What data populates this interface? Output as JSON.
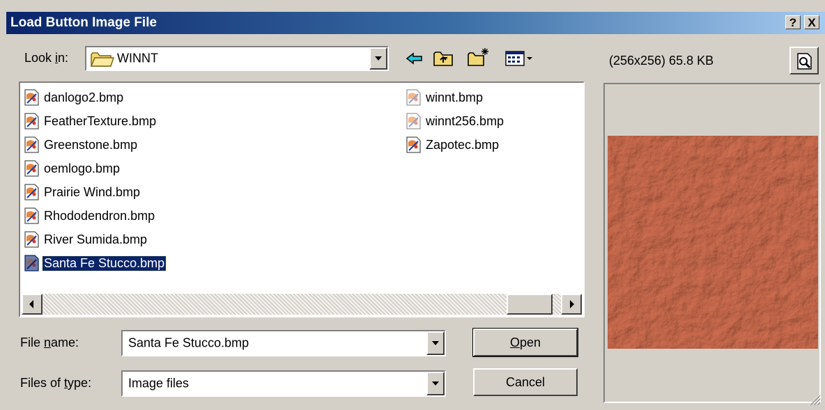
{
  "dialog": {
    "title": "Load Button Image File",
    "help_btn": "?",
    "close_btn": "X"
  },
  "lookin": {
    "label_pre": "Look ",
    "label_key": "i",
    "label_post": "n:",
    "value": "WINNT"
  },
  "preview": {
    "info": "(256x256)  65.8 KB",
    "image_color": "#c97a5f"
  },
  "files": [
    {
      "name": "danlogo2.bmp"
    },
    {
      "name": "FeatherTexture.bmp"
    },
    {
      "name": "Greenstone.bmp"
    },
    {
      "name": "oemlogo.bmp"
    },
    {
      "name": "Prairie Wind.bmp"
    },
    {
      "name": "Rhododendron.bmp"
    },
    {
      "name": "River Sumida.bmp"
    },
    {
      "name": "Santa Fe Stucco.bmp",
      "selected": true
    },
    {
      "name": "winnt.bmp"
    },
    {
      "name": "winnt256.bmp"
    },
    {
      "name": "Zapotec.bmp"
    }
  ],
  "filename": {
    "label_pre": "File ",
    "label_key": "n",
    "label_post": "ame:",
    "value": "Santa Fe Stucco.bmp"
  },
  "filetype": {
    "label_pre": "Files of ",
    "label_key": "t",
    "label_post": "ype:",
    "value": "Image files"
  },
  "buttons": {
    "open_key": "O",
    "open_rest": "pen",
    "cancel": "Cancel"
  },
  "colors": {
    "title_start": "#0a246a",
    "title_end": "#a6caf0",
    "face": "#d4d0c8",
    "selection": "#0a246a",
    "stucco": "#c97a5f"
  }
}
